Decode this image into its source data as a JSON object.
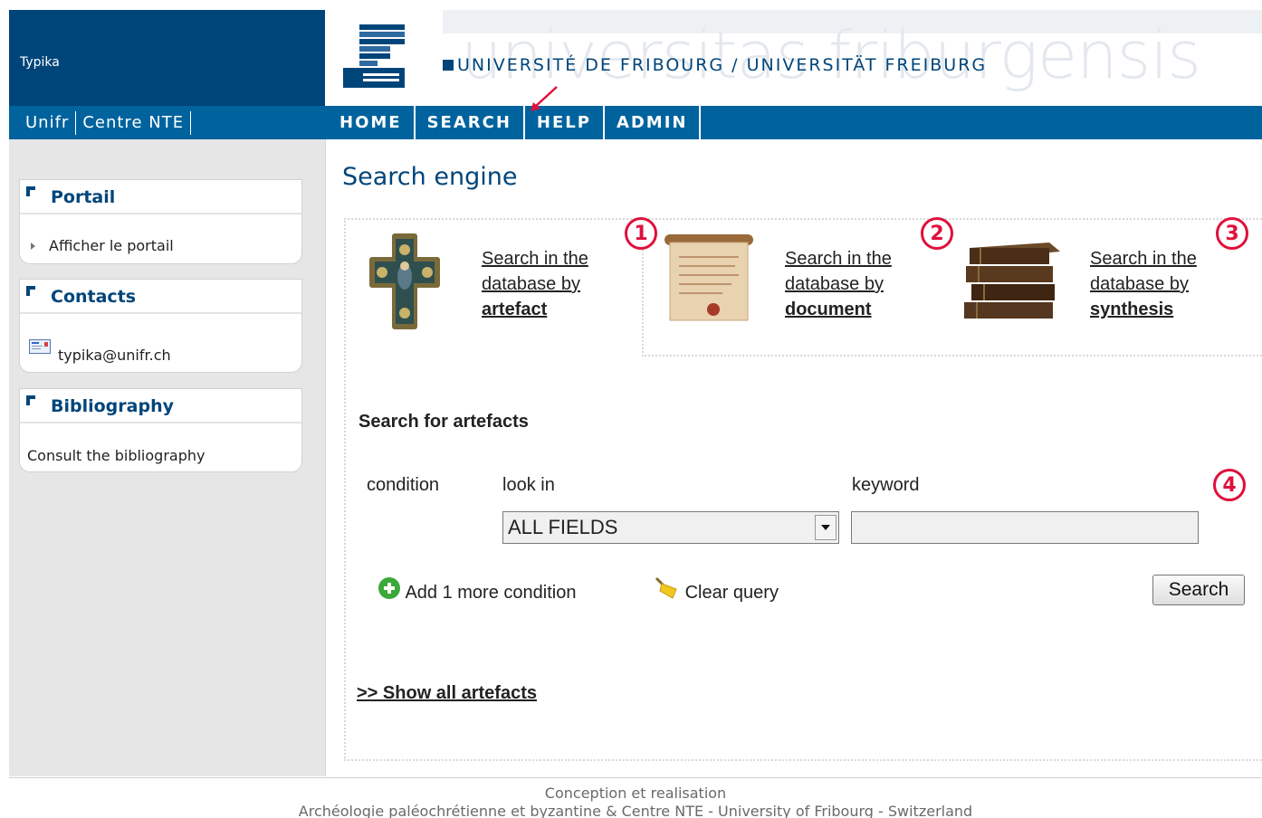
{
  "header": {
    "site_name": "Typika",
    "university": "UNIVERSITÉ DE FRIBOURG / UNIVERSITÄT FREIBURG",
    "watermark": "universitas friburgensis"
  },
  "subnav": [
    "Unifr",
    "Centre NTE"
  ],
  "mainnav": [
    "HOME",
    "SEARCH",
    "HELP",
    "ADMIN"
  ],
  "sidebar": {
    "boxes": [
      {
        "title": "Portail",
        "link": "Afficher le portail"
      },
      {
        "title": "Contacts",
        "link": "typika@unifr.ch"
      },
      {
        "title": "Bibliography",
        "link": "Consult the bibliography"
      }
    ]
  },
  "content": {
    "title": "Search engine",
    "options": [
      {
        "line1": "Search in the",
        "line2": "database by",
        "line3": "artefact"
      },
      {
        "line1": "Search in the",
        "line2": "database by",
        "line3": "document"
      },
      {
        "line1": "Search in the",
        "line2": "database by",
        "line3": "synthesis"
      }
    ],
    "markers": [
      "1",
      "2",
      "3",
      "4"
    ],
    "form": {
      "heading": "Search for artefacts",
      "col_condition": "condition",
      "col_lookin": "look in",
      "col_keyword": "keyword",
      "lookin_value": "ALL FIELDS",
      "add_condition": "Add 1 more condition",
      "clear_query": "Clear query",
      "search_button": "Search"
    },
    "show_all": ">> Show all artefacts"
  },
  "footer": {
    "line1": "Conception et realisation",
    "line2": "Archéologie paléochrétienne et byzantine &  Centre NTE  -  University of Fribourg  -  Switzerland"
  },
  "colors": {
    "brand_dark": "#00457a",
    "nav_blue": "#00639e",
    "marker_red": "#e0103c"
  }
}
